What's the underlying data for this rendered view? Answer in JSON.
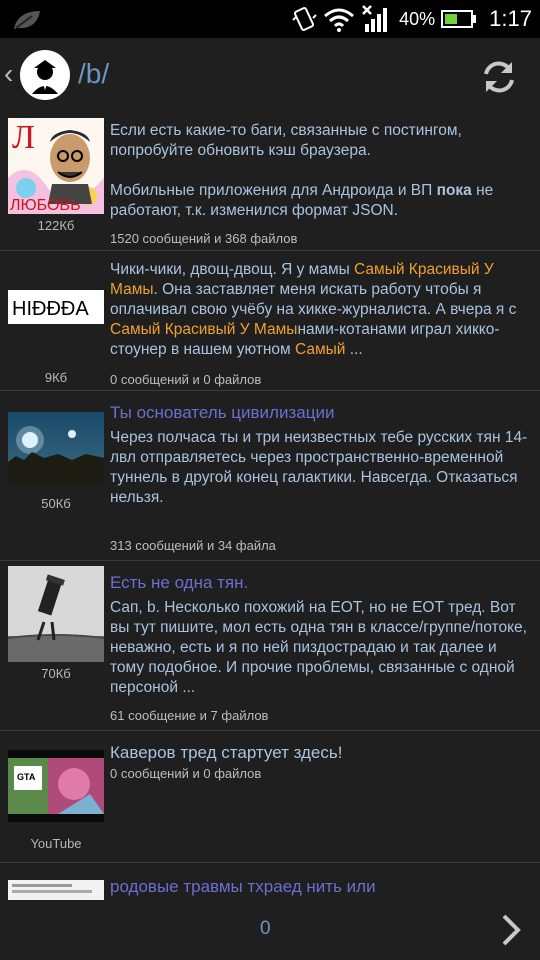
{
  "status_bar": {
    "battery_percent": "40%",
    "time": "1:17",
    "icons": [
      "leaf-icon",
      "vibrate-icon",
      "wifi-icon",
      "signal-icon",
      "battery-icon"
    ]
  },
  "action_bar": {
    "board": "/b/",
    "icons": [
      "back-arrow-icon",
      "board-logo",
      "refresh-icon"
    ]
  },
  "threads": [
    {
      "thumb_size": "122Кб",
      "title": "",
      "body_parts": [
        {
          "t": "Если есть какие-то баги, связанные с постингом, попробуйте обновить кэш браузера."
        },
        {
          "t": "Мобильные приложения для Андроида и ВП "
        },
        {
          "t": "пока",
          "b": true
        },
        {
          "t": " не работают, т.к. изменился формат JSON."
        }
      ],
      "counts": "1520 сообщений и 368 файлов"
    },
    {
      "thumb_size": "9Кб",
      "thumb_text": "HIĐĐĐA",
      "title": "",
      "body_parts": [
        {
          "t": "Чики-чики, двощ-двощ. Я у мамы "
        },
        {
          "t": "Самый Красивый У Мамы",
          "h": true
        },
        {
          "t": ". Она заставляет меня искать работу чтобы я оплачивал свою учёбу на хикке-журналиста. А вчера я с "
        },
        {
          "t": "Самый Красивый У Мамы",
          "h": true
        },
        {
          "t": "нами-котанами играл хикко-стоунер в нашем уютном "
        },
        {
          "t": "Самый",
          "h": true
        },
        {
          "t": " ..."
        }
      ],
      "counts": "0 сообщений и 0 файлов"
    },
    {
      "thumb_size": "50Кб",
      "title": "Ты основатель цивилизации",
      "body_parts": [
        {
          "t": "Через полчаса ты и три неизвестных тебе русских тян 14-лвл отправляетесь через пространственно-временной туннель в другой конец галактики. Навсегда. Отказаться нельзя."
        }
      ],
      "counts": "313 сообщений и 34 файла"
    },
    {
      "thumb_size": "70Кб",
      "title": "Есть не одна тян.",
      "body_parts": [
        {
          "t": "Сап, b. Несколько похожий на ЕОТ, но не ЕОТ тред. Вот вы тут пишите, мол есть одна тян в классе/группе/потоке, неважно, есть и я по ней пиздострадаю и так далее и тому подобное. И прочие проблемы, связанные с одной персоной ..."
        }
      ],
      "counts": "61 сообщение и 7 файлов"
    },
    {
      "thumb_size": "YouTube",
      "title": "Каверов тред стартует здесь!",
      "body_parts": [],
      "counts": "0 сообщений и 0 файлов"
    },
    {
      "thumb_size": "",
      "title": "родовые травмы тхраед нить или",
      "body_parts": [],
      "counts": ""
    }
  ],
  "bottom_bar": {
    "page": "0",
    "icons": [
      "chevron-right-icon"
    ]
  }
}
